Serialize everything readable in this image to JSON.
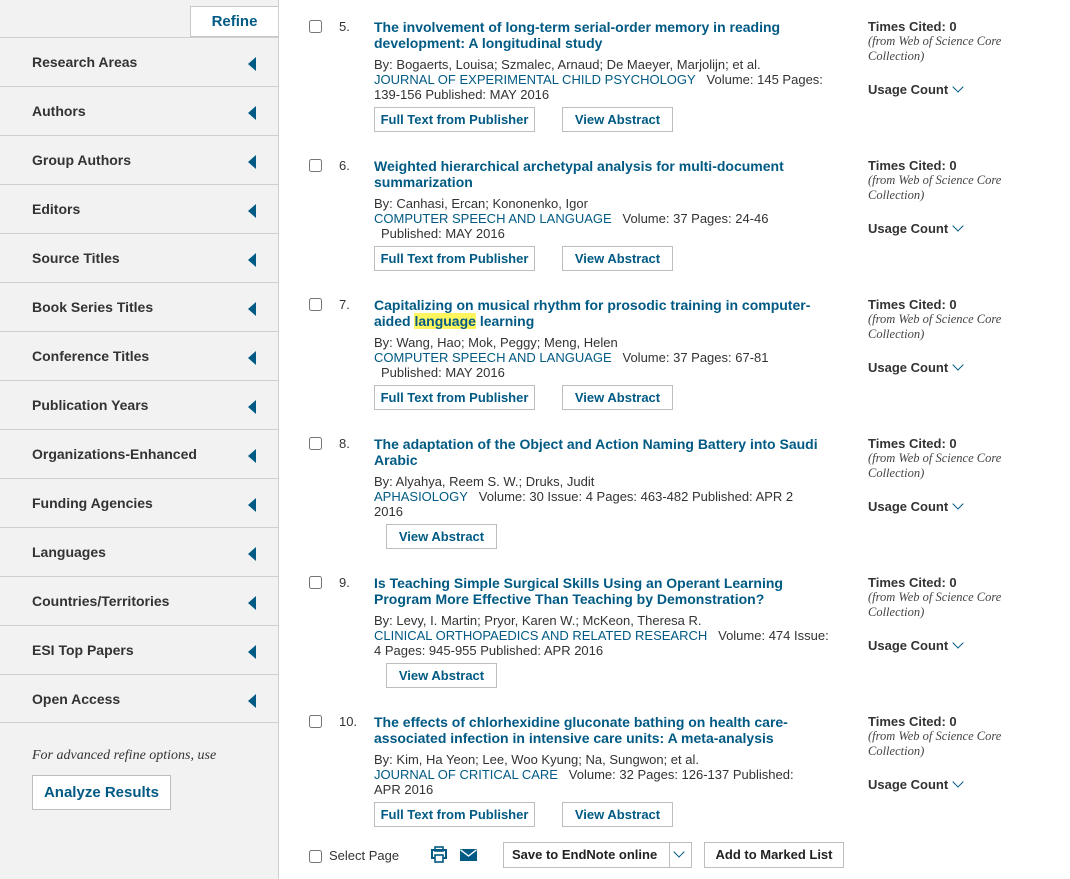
{
  "sidebar": {
    "refine_label": "Refine",
    "facets": [
      "Research Areas",
      "Authors",
      "Group Authors",
      "Editors",
      "Source Titles",
      "Book Series Titles",
      "Conference Titles",
      "Publication Years",
      "Organizations-Enhanced",
      "Funding Agencies",
      "Languages",
      "Countries/Territories",
      "ESI Top Papers",
      "Open Access"
    ],
    "advanced_note": "For advanced refine options, use",
    "analyze_label": "Analyze Results"
  },
  "common": {
    "full_text_label": "Full Text from Publisher",
    "view_abstract_label": "View Abstract",
    "times_cited": "Times Cited: 0",
    "cited_note_1": "(from Web of Science Core",
    "cited_note_2": "Collection)",
    "usage_label": "Usage Count"
  },
  "records": [
    {
      "num": "5.",
      "title_1": "The involvement of long-term serial-order memory in reading",
      "title_2": "development: A longitudinal study",
      "authors": "By: Bogaerts, Louisa; Szmalec, Arnaud; De Maeyer, Marjolijn; et al.",
      "journal": "JOURNAL OF EXPERIMENTAL CHILD PSYCHOLOGY",
      "journal_rest": "Volume: 145   Pages:",
      "details_2": "139-156   Published: MAY 2016"
    },
    {
      "num": "6.",
      "title_1": "Weighted hierarchical archetypal analysis for multi-document",
      "title_2": "summarization",
      "authors": "By: Canhasi, Ercan; Kononenko, Igor",
      "journal": "COMPUTER SPEECH AND LANGUAGE",
      "journal_rest": "Volume: 37   Pages: 24-46",
      "details_2": "Published: MAY 2016"
    },
    {
      "num": "7.",
      "title_1": "Capitalizing on musical rhythm for prosodic training in computer-",
      "title_2a": "aided ",
      "title_2hl": "language",
      "title_2b": " learning",
      "authors": "By: Wang, Hao; Mok, Peggy; Meng, Helen",
      "journal": "COMPUTER SPEECH AND LANGUAGE",
      "journal_rest": "Volume: 37   Pages: 67-81",
      "details_2": "Published: MAY 2016"
    },
    {
      "num": "8.",
      "title_1": "The adaptation of the Object and Action Naming Battery into Saudi",
      "title_2": "Arabic",
      "authors": "By: Alyahya, Reem S. W.; Druks, Judit",
      "journal": "APHASIOLOGY",
      "journal_rest": "Volume: 30   Issue: 4   Pages: 463-482   Published: APR 2",
      "details_2": "2016"
    },
    {
      "num": "9.",
      "title_1": "Is Teaching Simple Surgical Skills Using an Operant Learning",
      "title_2": "Program More Effective Than Teaching by Demonstration?",
      "authors": "By: Levy, I. Martin; Pryor, Karen W.; McKeon, Theresa R.",
      "journal": "CLINICAL ORTHOPAEDICS AND RELATED RESEARCH",
      "journal_rest": "Volume: 474   Issue:",
      "details_2": "4   Pages: 945-955   Published: APR 2016"
    },
    {
      "num": "10.",
      "title_1": "The effects of chlorhexidine gluconate bathing on health care-",
      "title_2": "associated infection in intensive care units: A meta-analysis",
      "authors": "By: Kim, Ha Yeon; Lee, Woo Kyung; Na, Sungwon; et al.",
      "journal": "JOURNAL OF CRITICAL CARE",
      "journal_rest": "Volume: 32   Pages: 126-137   Published:",
      "details_2": "APR 2016"
    }
  ],
  "toolbar": {
    "select_page_label": "Select Page",
    "print_icon": "print-icon",
    "email_icon": "email-icon",
    "save_label": "Save to EndNote online",
    "add_marked_label": "Add to Marked List"
  },
  "colors": {
    "link": "#005a84",
    "highlight": "#fff55f",
    "sidebar_bg": "#f2f2f2"
  }
}
